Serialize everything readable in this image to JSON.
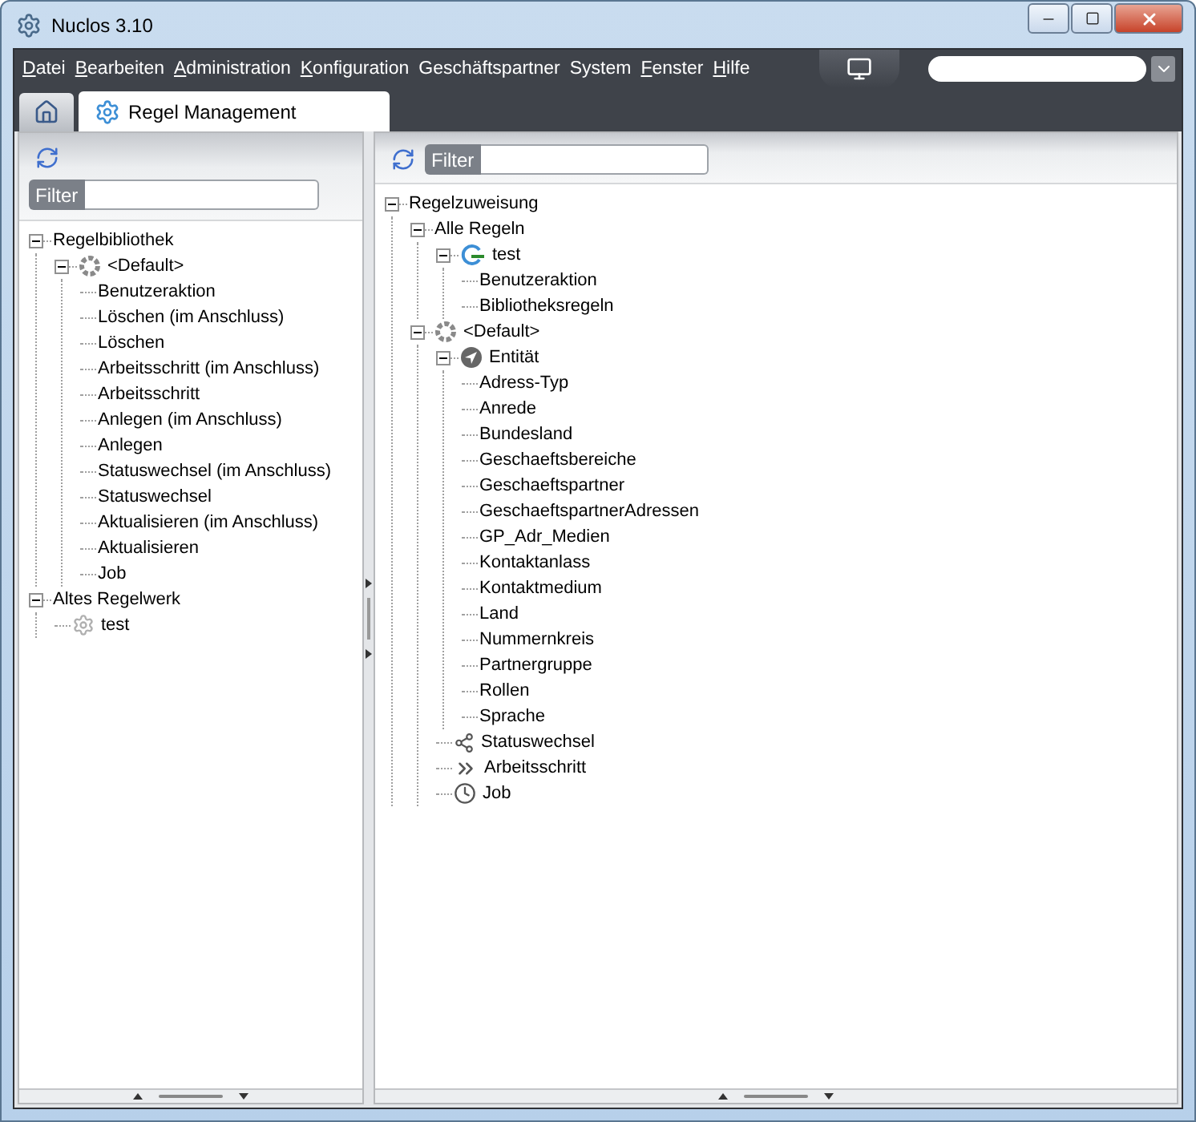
{
  "window": {
    "title": "Nuclos 3.10"
  },
  "menu": [
    {
      "label": "Datei",
      "underlined": true
    },
    {
      "label": "Bearbeiten",
      "underlined": true
    },
    {
      "label": "Administration",
      "underlined": true
    },
    {
      "label": "Konfiguration",
      "underlined": true
    },
    {
      "label": "Geschäftspartner",
      "underlined": false
    },
    {
      "label": "System",
      "underlined": false
    },
    {
      "label": "Fenster",
      "underlined": true
    },
    {
      "label": "Hilfe",
      "underlined": true
    }
  ],
  "tabs": [
    {
      "kind": "home",
      "selected": false
    },
    {
      "kind": "page",
      "label": "Regel Management",
      "selected": true
    }
  ],
  "left_panel": {
    "filter": {
      "label": "Filter"
    },
    "tree": [
      {
        "label": "Regelbibliothek",
        "expanded": true,
        "children": [
          {
            "label": "<Default>",
            "kind": "default",
            "expanded": true,
            "children": [
              {
                "label": "Benutzeraktion"
              },
              {
                "label": "Löschen (im Anschluss)"
              },
              {
                "label": "Löschen"
              },
              {
                "label": "Arbeitsschritt (im Anschluss)"
              },
              {
                "label": "Arbeitsschritt"
              },
              {
                "label": "Anlegen (im Anschluss)"
              },
              {
                "label": "Anlegen"
              },
              {
                "label": "Statuswechsel (im Anschluss)"
              },
              {
                "label": "Statuswechsel"
              },
              {
                "label": "Aktualisieren (im Anschluss)"
              },
              {
                "label": "Aktualisieren"
              },
              {
                "label": "Job"
              }
            ]
          }
        ]
      },
      {
        "label": "Altes Regelwerk",
        "expanded": true,
        "children": [
          {
            "label": "test",
            "kind": "gear"
          }
        ]
      }
    ]
  },
  "right_panel": {
    "filter": {
      "label": "Filter"
    },
    "tree": [
      {
        "label": "Regelzuweisung",
        "expanded": true,
        "children": [
          {
            "label": "Alle Regeln",
            "expanded": true,
            "children": [
              {
                "label": "test",
                "kind": "rule",
                "expanded": true,
                "children": [
                  {
                    "label": "Benutzeraktion"
                  },
                  {
                    "label": "Bibliotheksregeln"
                  }
                ]
              }
            ]
          },
          {
            "label": "<Default>",
            "kind": "default",
            "expanded": true,
            "children": [
              {
                "label": "Entität",
                "kind": "entity",
                "expanded": true,
                "children": [
                  {
                    "label": "Adress-Typ"
                  },
                  {
                    "label": "Anrede"
                  },
                  {
                    "label": "Bundesland"
                  },
                  {
                    "label": "Geschaeftsbereiche"
                  },
                  {
                    "label": "Geschaeftspartner"
                  },
                  {
                    "label": "GeschaeftspartnerAdressen"
                  },
                  {
                    "label": "GP_Adr_Medien"
                  },
                  {
                    "label": "Kontaktanlass"
                  },
                  {
                    "label": "Kontaktmedium"
                  },
                  {
                    "label": "Land"
                  },
                  {
                    "label": "Nummernkreis"
                  },
                  {
                    "label": "Partnergruppe"
                  },
                  {
                    "label": "Rollen"
                  },
                  {
                    "label": "Sprache"
                  }
                ]
              },
              {
                "label": "Statuswechsel",
                "kind": "status"
              },
              {
                "label": "Arbeitsschritt",
                "kind": "workstep"
              },
              {
                "label": "Job",
                "kind": "job"
              }
            ]
          }
        ]
      }
    ]
  }
}
